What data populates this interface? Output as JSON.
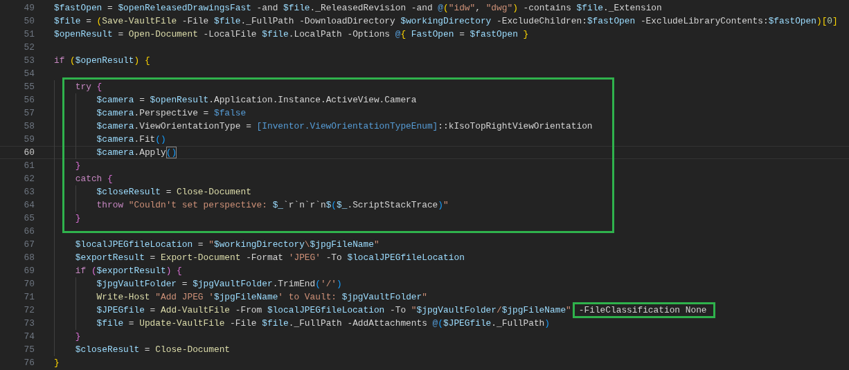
{
  "editor": {
    "lines": [
      {
        "kind": "line",
        "num": "49",
        "current": false,
        "tokens": [
          {
            "kind": "var",
            "text": "$fastOpen"
          },
          {
            "kind": "plain",
            "text": " = "
          },
          {
            "kind": "var",
            "text": "$openReleasedDrawingsFast"
          },
          {
            "kind": "plain",
            "text": " -and "
          },
          {
            "kind": "var",
            "text": "$file"
          },
          {
            "kind": "plain",
            "text": "._ReleasedRevision -and "
          },
          {
            "kind": "const",
            "text": "@"
          },
          {
            "kind": "b1",
            "text": "("
          },
          {
            "kind": "str",
            "text": "\"idw\""
          },
          {
            "kind": "plain",
            "text": ", "
          },
          {
            "kind": "str",
            "text": "\"dwg\""
          },
          {
            "kind": "b1",
            "text": ")"
          },
          {
            "kind": "plain",
            "text": " -contains "
          },
          {
            "kind": "var",
            "text": "$file"
          },
          {
            "kind": "plain",
            "text": "._Extension"
          }
        ]
      },
      {
        "kind": "line",
        "num": "50",
        "current": false,
        "tokens": [
          {
            "kind": "var",
            "text": "$file"
          },
          {
            "kind": "plain",
            "text": " = "
          },
          {
            "kind": "b1",
            "text": "("
          },
          {
            "kind": "cmd",
            "text": "Save-VaultFile"
          },
          {
            "kind": "plain",
            "text": " -File "
          },
          {
            "kind": "var",
            "text": "$file"
          },
          {
            "kind": "plain",
            "text": "._FullPath -DownloadDirectory "
          },
          {
            "kind": "var",
            "text": "$workingDirectory"
          },
          {
            "kind": "plain",
            "text": " -ExcludeChildren:"
          },
          {
            "kind": "var",
            "text": "$fastOpen"
          },
          {
            "kind": "plain",
            "text": " -ExcludeLibraryContents:"
          },
          {
            "kind": "var",
            "text": "$fastOpen"
          },
          {
            "kind": "b1",
            "text": ")["
          },
          {
            "kind": "num",
            "text": "0"
          },
          {
            "kind": "b1",
            "text": "]"
          }
        ]
      },
      {
        "kind": "line",
        "num": "51",
        "current": false,
        "tokens": [
          {
            "kind": "var",
            "text": "$openResult"
          },
          {
            "kind": "plain",
            "text": " = "
          },
          {
            "kind": "cmd",
            "text": "Open-Document"
          },
          {
            "kind": "plain",
            "text": " -LocalFile "
          },
          {
            "kind": "var",
            "text": "$file"
          },
          {
            "kind": "plain",
            "text": ".LocalPath -Options "
          },
          {
            "kind": "const",
            "text": "@"
          },
          {
            "kind": "b1",
            "text": "{"
          },
          {
            "kind": "var",
            "text": " FastOpen"
          },
          {
            "kind": "plain",
            "text": " = "
          },
          {
            "kind": "var",
            "text": "$fastOpen"
          },
          {
            "kind": "b1",
            "text": " }"
          }
        ]
      },
      {
        "kind": "line",
        "num": "52",
        "current": false
      },
      {
        "kind": "line",
        "num": "53",
        "current": false,
        "tokens": [
          {
            "kind": "kw",
            "text": "if "
          },
          {
            "kind": "b1",
            "text": "("
          },
          {
            "kind": "var",
            "text": "$openResult"
          },
          {
            "kind": "b1",
            "text": ") {"
          }
        ]
      },
      {
        "kind": "line",
        "num": "54",
        "current": false
      },
      {
        "kind": "highlight",
        "lines": [
          {
            "kind": "line",
            "num": "55",
            "current": false,
            "tokens": [
              {
                "kind": "kw",
                "text": "    try "
              },
              {
                "kind": "b2",
                "text": "{"
              }
            ]
          },
          {
            "kind": "line",
            "num": "56",
            "current": false,
            "tokens": [
              {
                "kind": "var",
                "text": "        $camera"
              },
              {
                "kind": "plain",
                "text": " = "
              },
              {
                "kind": "var",
                "text": "$openResult"
              },
              {
                "kind": "plain",
                "text": ".Application.Instance.ActiveView.Camera"
              }
            ]
          },
          {
            "kind": "line",
            "num": "57",
            "current": false,
            "tokens": [
              {
                "kind": "var",
                "text": "        $camera"
              },
              {
                "kind": "plain",
                "text": ".Perspective = "
              },
              {
                "kind": "const",
                "text": "$false"
              }
            ]
          },
          {
            "kind": "line",
            "num": "58",
            "current": false,
            "tokens": [
              {
                "kind": "var",
                "text": "        $camera"
              },
              {
                "kind": "plain",
                "text": ".ViewOrientationType = "
              },
              {
                "kind": "const",
                "text": "[Inventor.ViewOrientationTypeEnum]"
              },
              {
                "kind": "plain",
                "text": "::kIsoTopRightViewOrientation"
              }
            ]
          },
          {
            "kind": "line",
            "num": "59",
            "current": false,
            "tokens": [
              {
                "kind": "var",
                "text": "        $camera"
              },
              {
                "kind": "plain",
                "text": ".Fit"
              },
              {
                "kind": "b3",
                "text": "()"
              }
            ]
          },
          {
            "kind": "line",
            "num": "60",
            "current": true,
            "tokens": [
              {
                "kind": "var",
                "text": "        $camera"
              },
              {
                "kind": "plain",
                "text": ".Apply"
              },
              {
                "kind": "match",
                "text": "()"
              }
            ]
          },
          {
            "kind": "line",
            "num": "61",
            "current": false,
            "tokens": [
              {
                "kind": "b2",
                "text": "    }"
              }
            ]
          },
          {
            "kind": "line",
            "num": "62",
            "current": false,
            "tokens": [
              {
                "kind": "kw",
                "text": "    catch "
              },
              {
                "kind": "b2",
                "text": "{"
              }
            ]
          },
          {
            "kind": "line",
            "num": "63",
            "current": false,
            "tokens": [
              {
                "kind": "var",
                "text": "        $closeResult"
              },
              {
                "kind": "plain",
                "text": " = "
              },
              {
                "kind": "cmd",
                "text": "Close-Document"
              }
            ]
          },
          {
            "kind": "line",
            "num": "64",
            "current": false,
            "tokens": [
              {
                "kind": "kw",
                "text": "        throw "
              },
              {
                "kind": "str",
                "text": "\"Couldn't set perspective: "
              },
              {
                "kind": "var",
                "text": "$_"
              },
              {
                "kind": "plain",
                "text": "`r`n`r`n"
              },
              {
                "kind": "var",
                "text": "$"
              },
              {
                "kind": "b3",
                "text": "("
              },
              {
                "kind": "var",
                "text": "$_"
              },
              {
                "kind": "plain",
                "text": ".ScriptStackTrace"
              },
              {
                "kind": "b3",
                "text": ")"
              },
              {
                "kind": "str",
                "text": "\""
              }
            ]
          },
          {
            "kind": "line",
            "num": "65",
            "current": false,
            "tokens": [
              {
                "kind": "b2",
                "text": "    }"
              }
            ]
          }
        ]
      },
      {
        "kind": "line",
        "num": "66",
        "current": false
      },
      {
        "kind": "line",
        "num": "67",
        "current": false,
        "tokens": [
          {
            "kind": "var",
            "text": "    $localJPEGfileLocation"
          },
          {
            "kind": "plain",
            "text": " = "
          },
          {
            "kind": "str",
            "text": "\""
          },
          {
            "kind": "var",
            "text": "$workingDirectory"
          },
          {
            "kind": "str",
            "text": "\\"
          },
          {
            "kind": "var",
            "text": "$jpgFileName"
          },
          {
            "kind": "str",
            "text": "\""
          }
        ]
      },
      {
        "kind": "line",
        "num": "68",
        "current": false,
        "tokens": [
          {
            "kind": "var",
            "text": "    $exportResult"
          },
          {
            "kind": "plain",
            "text": " = "
          },
          {
            "kind": "cmd",
            "text": "Export-Document"
          },
          {
            "kind": "plain",
            "text": " -Format "
          },
          {
            "kind": "str",
            "text": "'JPEG'"
          },
          {
            "kind": "plain",
            "text": " -To "
          },
          {
            "kind": "var",
            "text": "$localJPEGfileLocation"
          }
        ]
      },
      {
        "kind": "line",
        "num": "69",
        "current": false,
        "tokens": [
          {
            "kind": "kw",
            "text": "    if "
          },
          {
            "kind": "b2",
            "text": "("
          },
          {
            "kind": "var",
            "text": "$exportResult"
          },
          {
            "kind": "b2",
            "text": ") {"
          }
        ]
      },
      {
        "kind": "line",
        "num": "70",
        "current": false,
        "tokens": [
          {
            "kind": "var",
            "text": "        $jpgVaultFolder"
          },
          {
            "kind": "plain",
            "text": " = "
          },
          {
            "kind": "var",
            "text": "$jpgVaultFolder"
          },
          {
            "kind": "plain",
            "text": ".TrimEnd"
          },
          {
            "kind": "b3",
            "text": "("
          },
          {
            "kind": "str",
            "text": "'/'"
          },
          {
            "kind": "b3",
            "text": ")"
          }
        ]
      },
      {
        "kind": "line",
        "num": "71",
        "current": false,
        "tokens": [
          {
            "kind": "cmd",
            "text": "        Write-Host"
          },
          {
            "kind": "str",
            "text": " \"Add JPEG '"
          },
          {
            "kind": "var",
            "text": "$jpgFileName"
          },
          {
            "kind": "str",
            "text": "' to Vault: "
          },
          {
            "kind": "var",
            "text": "$jpgVaultFolder"
          },
          {
            "kind": "str",
            "text": "\""
          }
        ]
      },
      {
        "kind": "line",
        "num": "72",
        "current": false,
        "tokens": [
          {
            "kind": "var",
            "text": "        $JPEGfile"
          },
          {
            "kind": "plain",
            "text": " = "
          },
          {
            "kind": "cmd",
            "text": "Add-VaultFile"
          },
          {
            "kind": "plain",
            "text": " -From "
          },
          {
            "kind": "var",
            "text": "$localJPEGfileLocation"
          },
          {
            "kind": "plain",
            "text": " -To "
          },
          {
            "kind": "str",
            "text": "\""
          },
          {
            "kind": "var",
            "text": "$jpgVaultFolder"
          },
          {
            "kind": "str",
            "text": "/"
          },
          {
            "kind": "var",
            "text": "$jpgFileName"
          },
          {
            "kind": "str",
            "text": "\""
          },
          {
            "kind": "boxed",
            "text": "-FileClassification None"
          }
        ]
      },
      {
        "kind": "line",
        "num": "73",
        "current": false,
        "tokens": [
          {
            "kind": "var",
            "text": "        $file"
          },
          {
            "kind": "plain",
            "text": " = "
          },
          {
            "kind": "cmd",
            "text": "Update-VaultFile"
          },
          {
            "kind": "plain",
            "text": " -File "
          },
          {
            "kind": "var",
            "text": "$file"
          },
          {
            "kind": "plain",
            "text": "._FullPath -AddAttachments "
          },
          {
            "kind": "const",
            "text": "@"
          },
          {
            "kind": "b3",
            "text": "("
          },
          {
            "kind": "var",
            "text": "$JPEGfile"
          },
          {
            "kind": "plain",
            "text": "._FullPath"
          },
          {
            "kind": "b3",
            "text": ")"
          }
        ]
      },
      {
        "kind": "line",
        "num": "74",
        "current": false,
        "tokens": [
          {
            "kind": "b2",
            "text": "    }"
          }
        ]
      },
      {
        "kind": "line",
        "num": "75",
        "current": false,
        "tokens": [
          {
            "kind": "var",
            "text": "    $closeResult"
          },
          {
            "kind": "plain",
            "text": " = "
          },
          {
            "kind": "cmd",
            "text": "Close-Document"
          }
        ]
      },
      {
        "kind": "line",
        "num": "76",
        "current": false,
        "tokens": [
          {
            "kind": "b1",
            "text": "}"
          }
        ]
      }
    ]
  }
}
